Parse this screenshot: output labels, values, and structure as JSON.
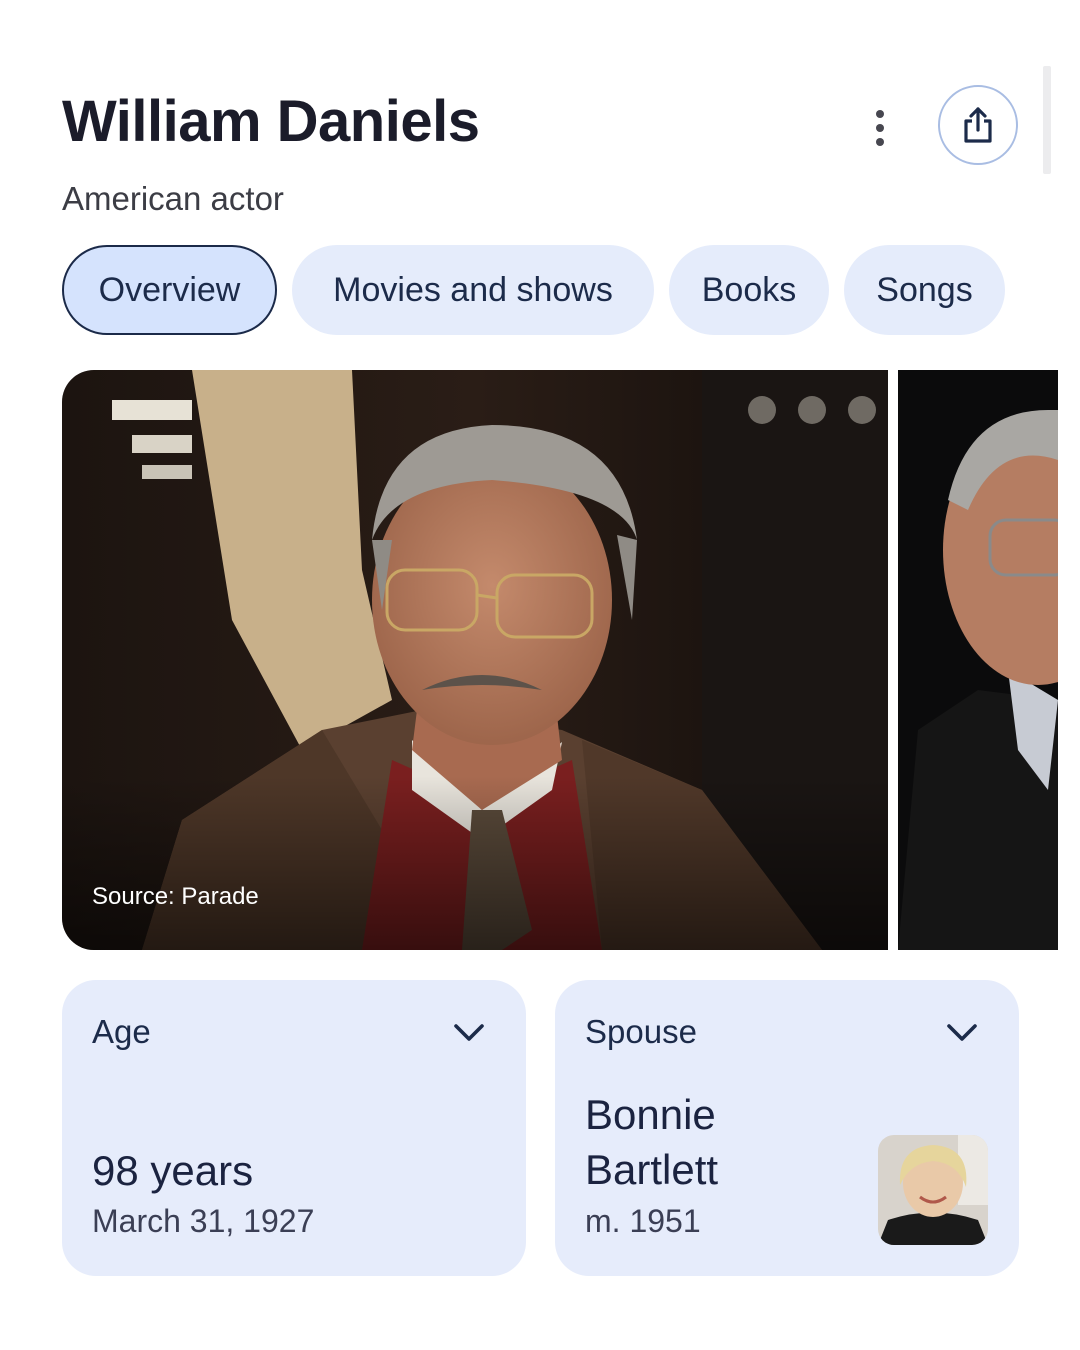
{
  "header": {
    "title": "William Daniels",
    "subtitle": "American actor",
    "more_icon": "more-vert-icon",
    "share_icon": "share-icon"
  },
  "tabs": [
    {
      "label": "Overview",
      "active": true
    },
    {
      "label": "Movies and shows",
      "active": false
    },
    {
      "label": "Books",
      "active": false
    },
    {
      "label": "Songs",
      "active": false
    }
  ],
  "images": {
    "main_source": "Source: Parade"
  },
  "cards": {
    "age": {
      "label": "Age",
      "value": "98 years",
      "sub": "March 31, 1927",
      "icon": "chevron-down-icon"
    },
    "spouse": {
      "label": "Spouse",
      "value_line1": "Bonnie",
      "value_line2": "Bartlett",
      "sub": "m. 1951",
      "icon": "chevron-down-icon"
    }
  },
  "colors": {
    "chip_bg": "#e5ecfb",
    "chip_active_bg": "#d5e3fd",
    "card_bg": "#e6ecfb",
    "title": "#1b1c2a"
  }
}
